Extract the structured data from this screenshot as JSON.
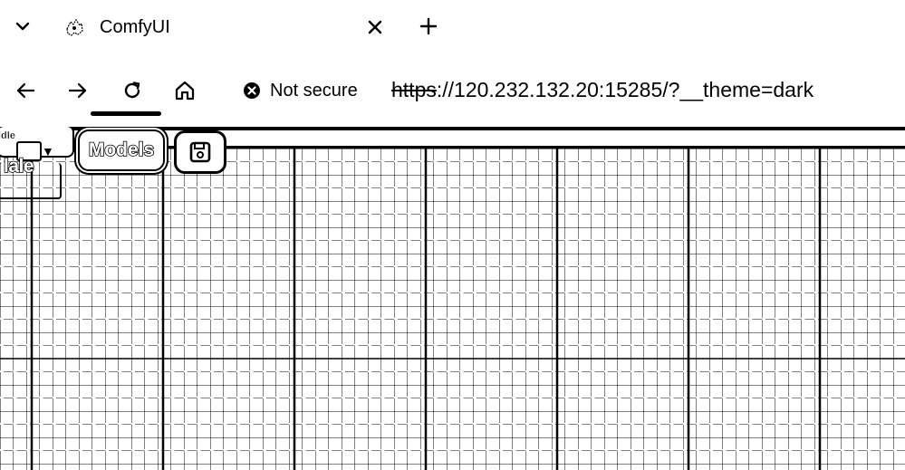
{
  "browser": {
    "tab": {
      "title": "ComfyUI",
      "favicon": "comfy-logo-icon"
    },
    "tab_strip": {
      "tab_list_icon": "chevron-down-icon",
      "close_icon": "close-icon",
      "new_tab_icon": "plus-icon"
    },
    "toolbar": {
      "back_icon": "arrow-left-icon",
      "forward_icon": "arrow-right-icon",
      "reload_icon": "reload-icon",
      "home_icon": "home-icon",
      "security_icon": "warning-circle-icon",
      "security_label": "Not secure",
      "url_scheme": "https",
      "url_rest": "://120.232.132.20:15285/?__theme=dark"
    }
  },
  "app": {
    "menu": {
      "queue_label_small": "ldle",
      "queue_label": "lale",
      "models_label": "Models",
      "save_icon": "save-icon"
    },
    "colors": {
      "foreground": "#000000",
      "background": "#ffffff"
    }
  }
}
